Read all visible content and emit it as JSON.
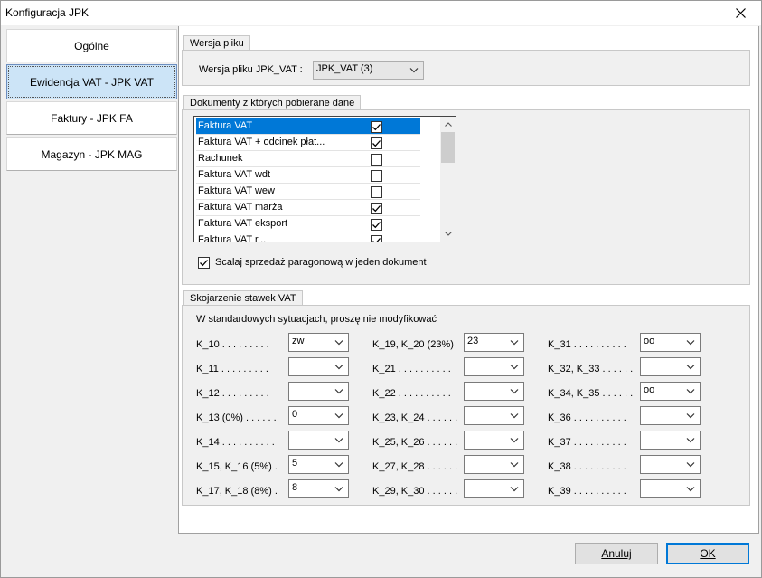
{
  "window": {
    "title": "Konfiguracja JPK"
  },
  "nav": {
    "items": [
      {
        "label": "Ogólne",
        "active": false
      },
      {
        "label": "Ewidencja VAT - JPK VAT",
        "active": true
      },
      {
        "label": "Faktury - JPK FA",
        "active": false
      },
      {
        "label": "Magazyn - JPK MAG",
        "active": false
      }
    ]
  },
  "version_group": {
    "title": "Wersja pliku",
    "field_label": "Wersja pliku JPK_VAT :",
    "field_value": "JPK_VAT (3)"
  },
  "documents_group": {
    "title": "Dokumenty z których pobierane dane",
    "items": [
      {
        "label": "Faktura VAT",
        "checked": true,
        "selected": true
      },
      {
        "label": "Faktura VAT + odcinek płat...",
        "checked": true,
        "selected": false
      },
      {
        "label": "Rachunek",
        "checked": false,
        "selected": false
      },
      {
        "label": "Faktura VAT  wdt",
        "checked": false,
        "selected": false
      },
      {
        "label": "Faktura VAT  wew",
        "checked": false,
        "selected": false
      },
      {
        "label": "Faktura VAT marża",
        "checked": true,
        "selected": false
      },
      {
        "label": "Faktura VAT eksport",
        "checked": true,
        "selected": false
      },
      {
        "label": "Faktura VAT r...",
        "checked": true,
        "selected": false
      }
    ],
    "merge_checkbox": {
      "label": "Scalaj sprzedaż paragonową w jeden dokument",
      "checked": true
    }
  },
  "rates_group": {
    "title": "Skojarzenie stawek VAT",
    "note": "W standardowych sytuacjach, proszę nie modyfikować",
    "columns": [
      [
        {
          "label": "K_10 . . . . . . . . .",
          "value": "zw"
        },
        {
          "label": "K_11 . . . . . . . . .",
          "value": ""
        },
        {
          "label": "K_12 . . . . . . . . .",
          "value": ""
        },
        {
          "label": "K_13 (0%) . . . . . .",
          "value": "0"
        },
        {
          "label": "K_14 . . . . . . . . . .",
          "value": ""
        },
        {
          "label": "K_15, K_16 (5%) .",
          "value": "5"
        },
        {
          "label": "K_17, K_18 (8%) .",
          "value": "8"
        }
      ],
      [
        {
          "label": "K_19, K_20 (23%)",
          "value": "23"
        },
        {
          "label": "K_21 . . . . . . . . . .",
          "value": ""
        },
        {
          "label": "K_22 . . . . . . . . . .",
          "value": ""
        },
        {
          "label": "K_23, K_24 . . . . . .",
          "value": ""
        },
        {
          "label": "K_25, K_26 . . . . . .",
          "value": ""
        },
        {
          "label": "K_27, K_28 . . . . . .",
          "value": ""
        },
        {
          "label": "K_29, K_30 . . . . . .",
          "value": ""
        }
      ],
      [
        {
          "label": "K_31 . . . . . . . . . .",
          "value": "oo"
        },
        {
          "label": "K_32, K_33 . . . . . .",
          "value": ""
        },
        {
          "label": "K_34, K_35 . . . . . .",
          "value": "oo"
        },
        {
          "label": "K_36 . . . . . . . . . .",
          "value": ""
        },
        {
          "label": "K_37 . . . . . . . . . .",
          "value": ""
        },
        {
          "label": "K_38 . . . . . . . . . .",
          "value": ""
        },
        {
          "label": "K_39 . . . . . . . . . .",
          "value": ""
        }
      ]
    ]
  },
  "buttons": {
    "cancel_label": "Anuluj",
    "ok_label": "OK"
  }
}
